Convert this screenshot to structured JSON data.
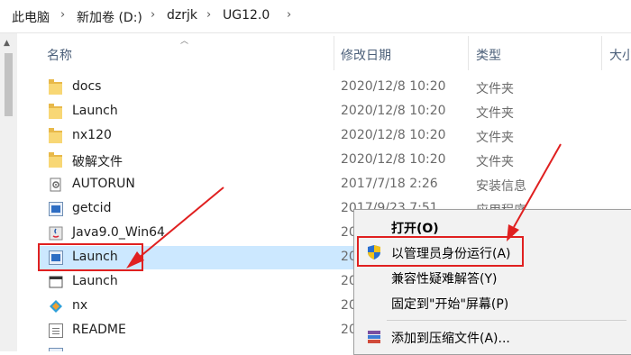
{
  "breadcrumb": [
    "此电脑",
    "新加卷 (D:)",
    "dzrjk",
    "UG12.0"
  ],
  "columns": {
    "name": "名称",
    "date": "修改日期",
    "type": "类型",
    "size": "大小"
  },
  "files": [
    {
      "name": "docs",
      "date": "2020/12/8 10:20",
      "type": "文件夹",
      "icon": "folder-icon"
    },
    {
      "name": "Launch",
      "date": "2020/12/8 10:20",
      "type": "文件夹",
      "icon": "folder-icon"
    },
    {
      "name": "nx120",
      "date": "2020/12/8 10:20",
      "type": "文件夹",
      "icon": "folder-icon"
    },
    {
      "name": "破解文件",
      "date": "2020/12/8 10:20",
      "type": "文件夹",
      "icon": "folder-icon"
    },
    {
      "name": "AUTORUN",
      "date": "2017/7/18 2:26",
      "type": "安装信息",
      "icon": "setup-info-icon"
    },
    {
      "name": "getcid",
      "date": "2017/9/23 7:51",
      "type": "应用程序",
      "icon": "application-icon"
    },
    {
      "name": "Java9.0_Win64",
      "date": "20",
      "type": "",
      "icon": "java-installer-icon"
    },
    {
      "name": "Launch",
      "date": "20",
      "type": "",
      "icon": "application-icon"
    },
    {
      "name": "Launch",
      "date": "20",
      "type": "",
      "icon": "window-app-icon"
    },
    {
      "name": "nx",
      "date": "20",
      "type": "",
      "icon": "nx-app-icon"
    },
    {
      "name": "README",
      "date": "20",
      "type": "",
      "icon": "text-document-icon"
    }
  ],
  "context_menu": {
    "open": "打开(O)",
    "run_as_admin": "以管理员身份运行(A)",
    "troubleshoot": "兼容性疑难解答(Y)",
    "pin_start": "固定到\"开始\"屏幕(P)",
    "add_archive": "添加到压缩文件(A)..."
  },
  "colors": {
    "selection": "#cce8ff",
    "annotation": "#e02020",
    "folder": "#f8d775"
  }
}
